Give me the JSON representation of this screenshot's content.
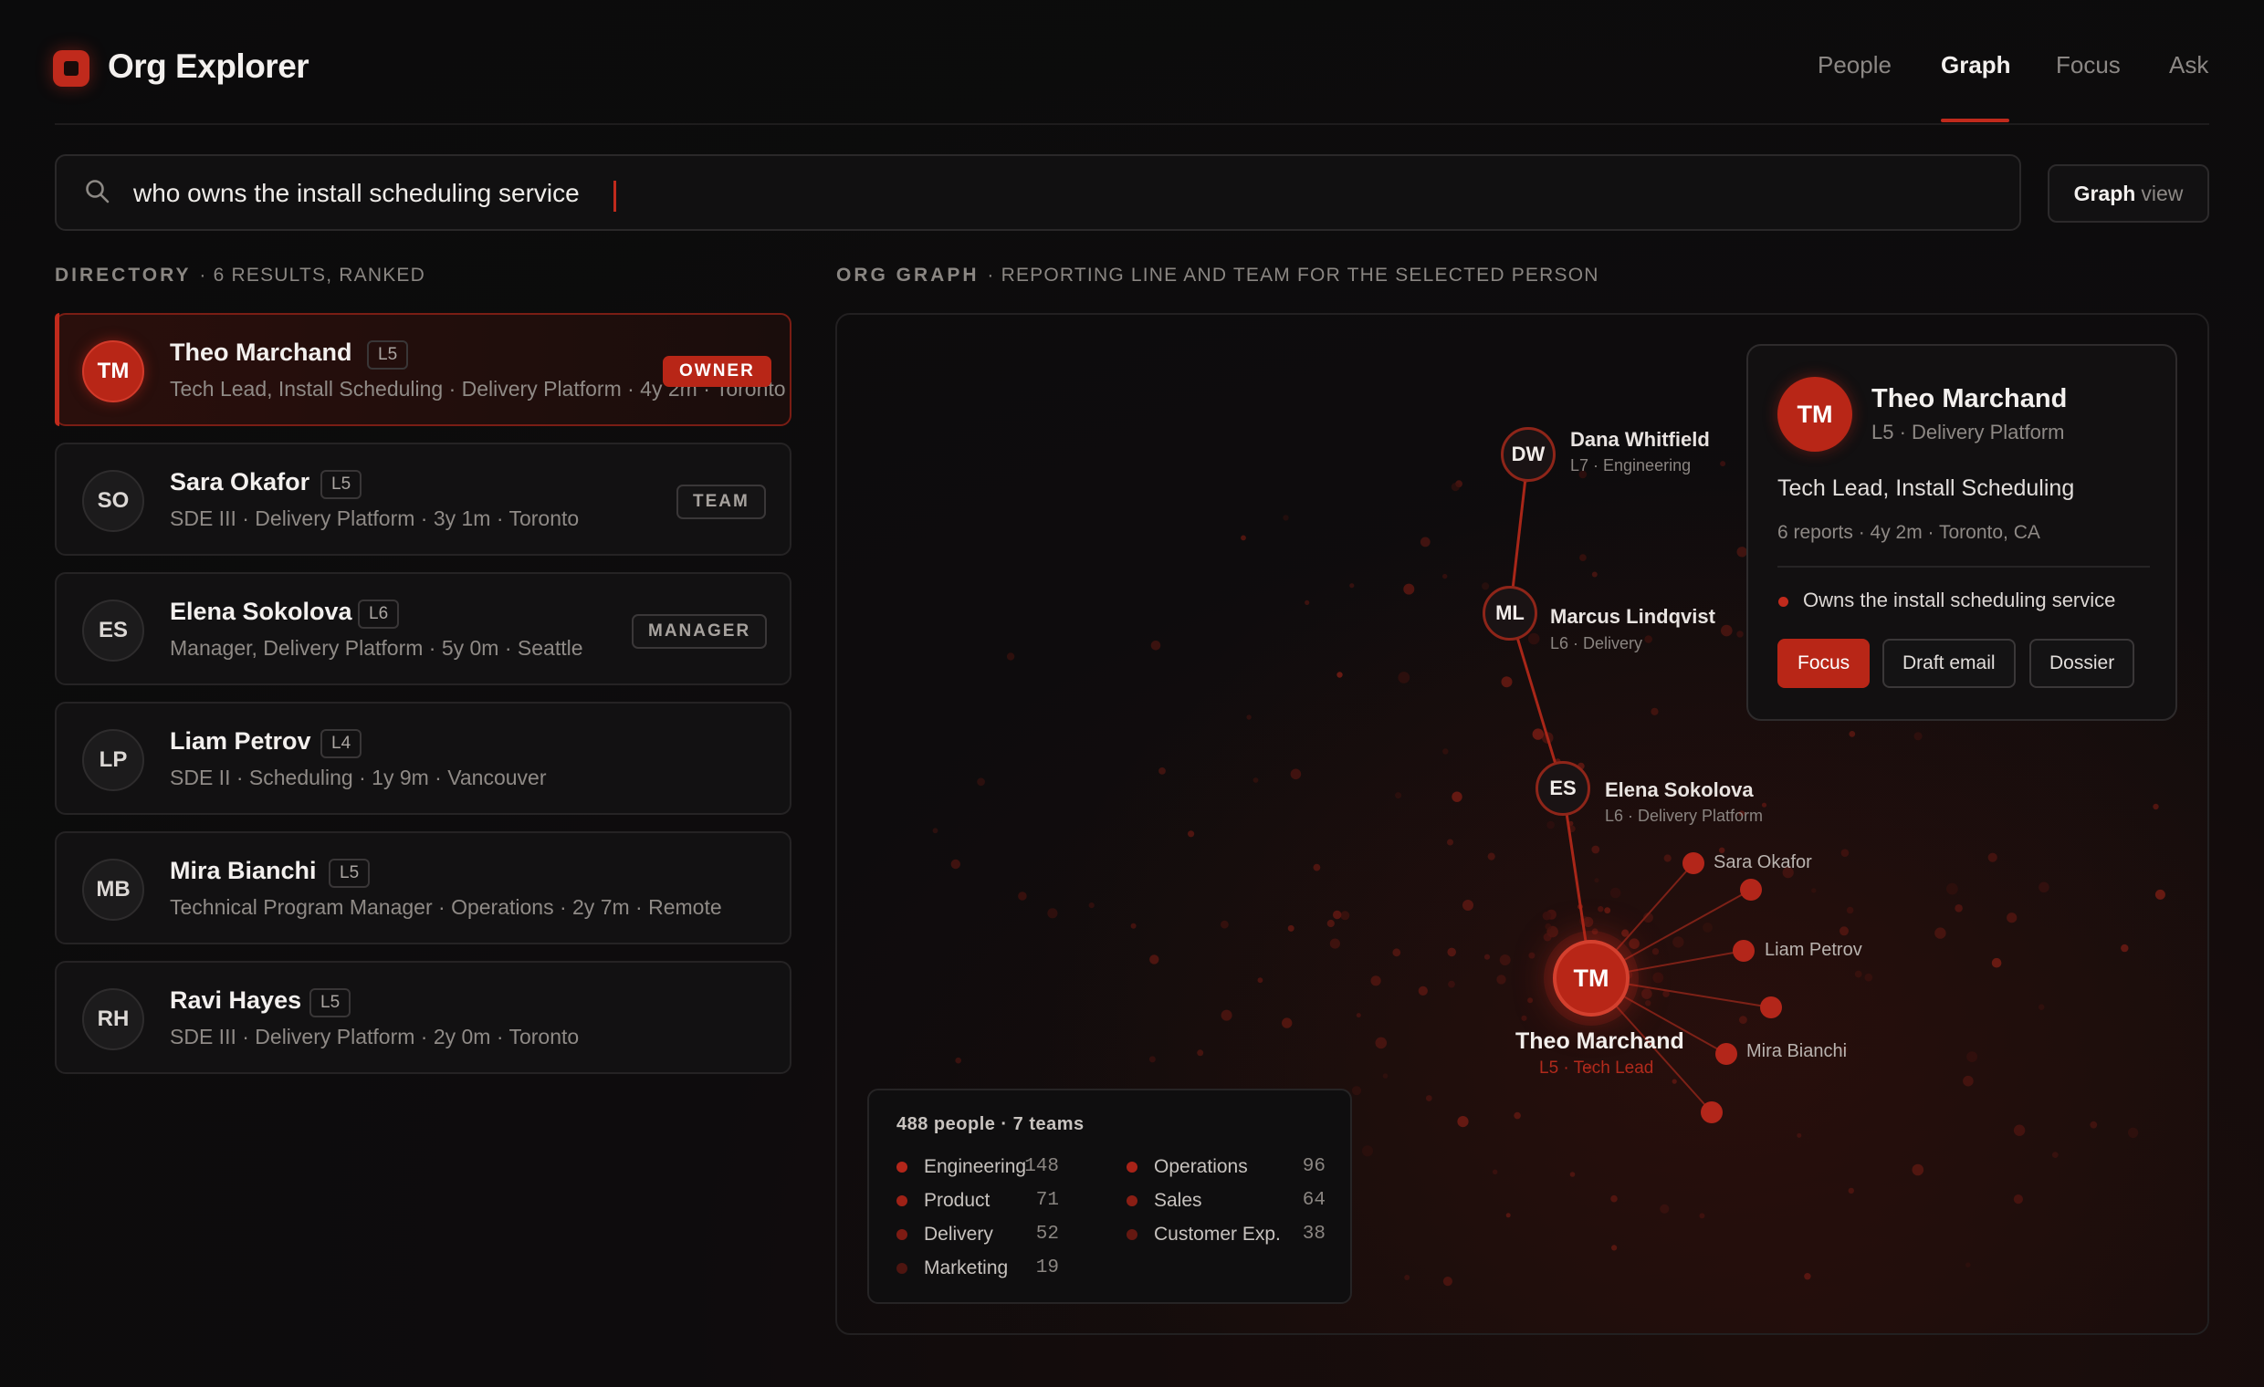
{
  "app": {
    "title": "Org Explorer",
    "logo_icon": "app-logo-icon"
  },
  "nav": {
    "tabs": [
      {
        "label": "People",
        "active": false
      },
      {
        "label": "Graph",
        "active": true
      },
      {
        "label": "Focus",
        "active": false
      },
      {
        "label": "Ask",
        "active": false
      }
    ]
  },
  "search": {
    "value": "who owns the install scheduling service",
    "icon": "search-icon"
  },
  "view_toggle": {
    "bold": "Graph",
    "rest": "view"
  },
  "directory": {
    "label": "DIRECTORY",
    "count": "· 6 RESULTS, RANKED",
    "people": [
      {
        "initials": "TM",
        "name": "Theo Marchand",
        "level": "L5",
        "sub": "Tech Lead, Install Scheduling · Delivery Platform · 4y 2m · Toronto",
        "tag": "OWNER",
        "selected": true
      },
      {
        "initials": "SO",
        "name": "Sara Okafor",
        "level": "L5",
        "sub": "SDE III · Delivery Platform · 3y 1m · Toronto",
        "tag": "TEAM",
        "selected": false
      },
      {
        "initials": "ES",
        "name": "Elena Sokolova",
        "level": "L6",
        "sub": "Manager, Delivery Platform · 5y 0m · Seattle",
        "tag": "MANAGER",
        "selected": false
      },
      {
        "initials": "LP",
        "name": "Liam Petrov",
        "level": "L4",
        "sub": "SDE II · Scheduling · 1y 9m · Vancouver",
        "tag": "",
        "selected": false
      },
      {
        "initials": "MB",
        "name": "Mira Bianchi",
        "level": "L5",
        "sub": "Technical Program Manager · Operations · 2y 7m · Remote",
        "tag": "",
        "selected": false
      },
      {
        "initials": "RH",
        "name": "Ravi Hayes",
        "level": "L5",
        "sub": "SDE III · Delivery Platform · 2y 0m · Toronto",
        "tag": "",
        "selected": false
      }
    ]
  },
  "graph": {
    "label": "ORG GRAPH",
    "caption": "· REPORTING LINE AND TEAM FOR THE SELECTED PERSON",
    "chain": [
      {
        "initials": "DW",
        "name": "Dana Whitfield",
        "sub": "L7 · Engineering"
      },
      {
        "initials": "ML",
        "name": "Marcus Lindqvist",
        "sub": "L6 · Delivery"
      },
      {
        "initials": "ES",
        "name": "Elena Sokolova",
        "sub": "L6 · Delivery Platform"
      }
    ],
    "focus": {
      "initials": "TM",
      "name": "Theo Marchand",
      "sub": "L5 · Tech Lead"
    },
    "reports": [
      "Sara Okafor",
      "",
      "Liam Petrov",
      "",
      "Mira Bianchi",
      ""
    ]
  },
  "detail": {
    "initials": "TM",
    "name": "Theo Marchand",
    "sub": "L5 · Delivery Platform",
    "title": "Tech Lead, Install Scheduling",
    "meta": "6 reports · 4y 2m · Toronto, CA",
    "owns": "Owns the install scheduling service",
    "buttons": {
      "focus": "Focus",
      "draft": "Draft email",
      "dossier": "Dossier"
    }
  },
  "legend": {
    "heading": "488 people · 7 teams",
    "teams": [
      {
        "name": "Engineering",
        "count": "148",
        "color": "#b3261a"
      },
      {
        "name": "Product",
        "count": "71",
        "color": "#9e2116"
      },
      {
        "name": "Delivery",
        "count": "52",
        "color": "#7e1b13"
      },
      {
        "name": "Marketing",
        "count": "19",
        "color": "#4e1510"
      },
      {
        "name": "Operations",
        "count": "96",
        "color": "#a82318"
      },
      {
        "name": "Sales",
        "count": "64",
        "color": "#8a1e14"
      },
      {
        "name": "Customer Exp.",
        "count": "38",
        "color": "#651811"
      }
    ]
  },
  "colors": {
    "accent": "#c02a1c",
    "background": "#0b0b0c"
  }
}
